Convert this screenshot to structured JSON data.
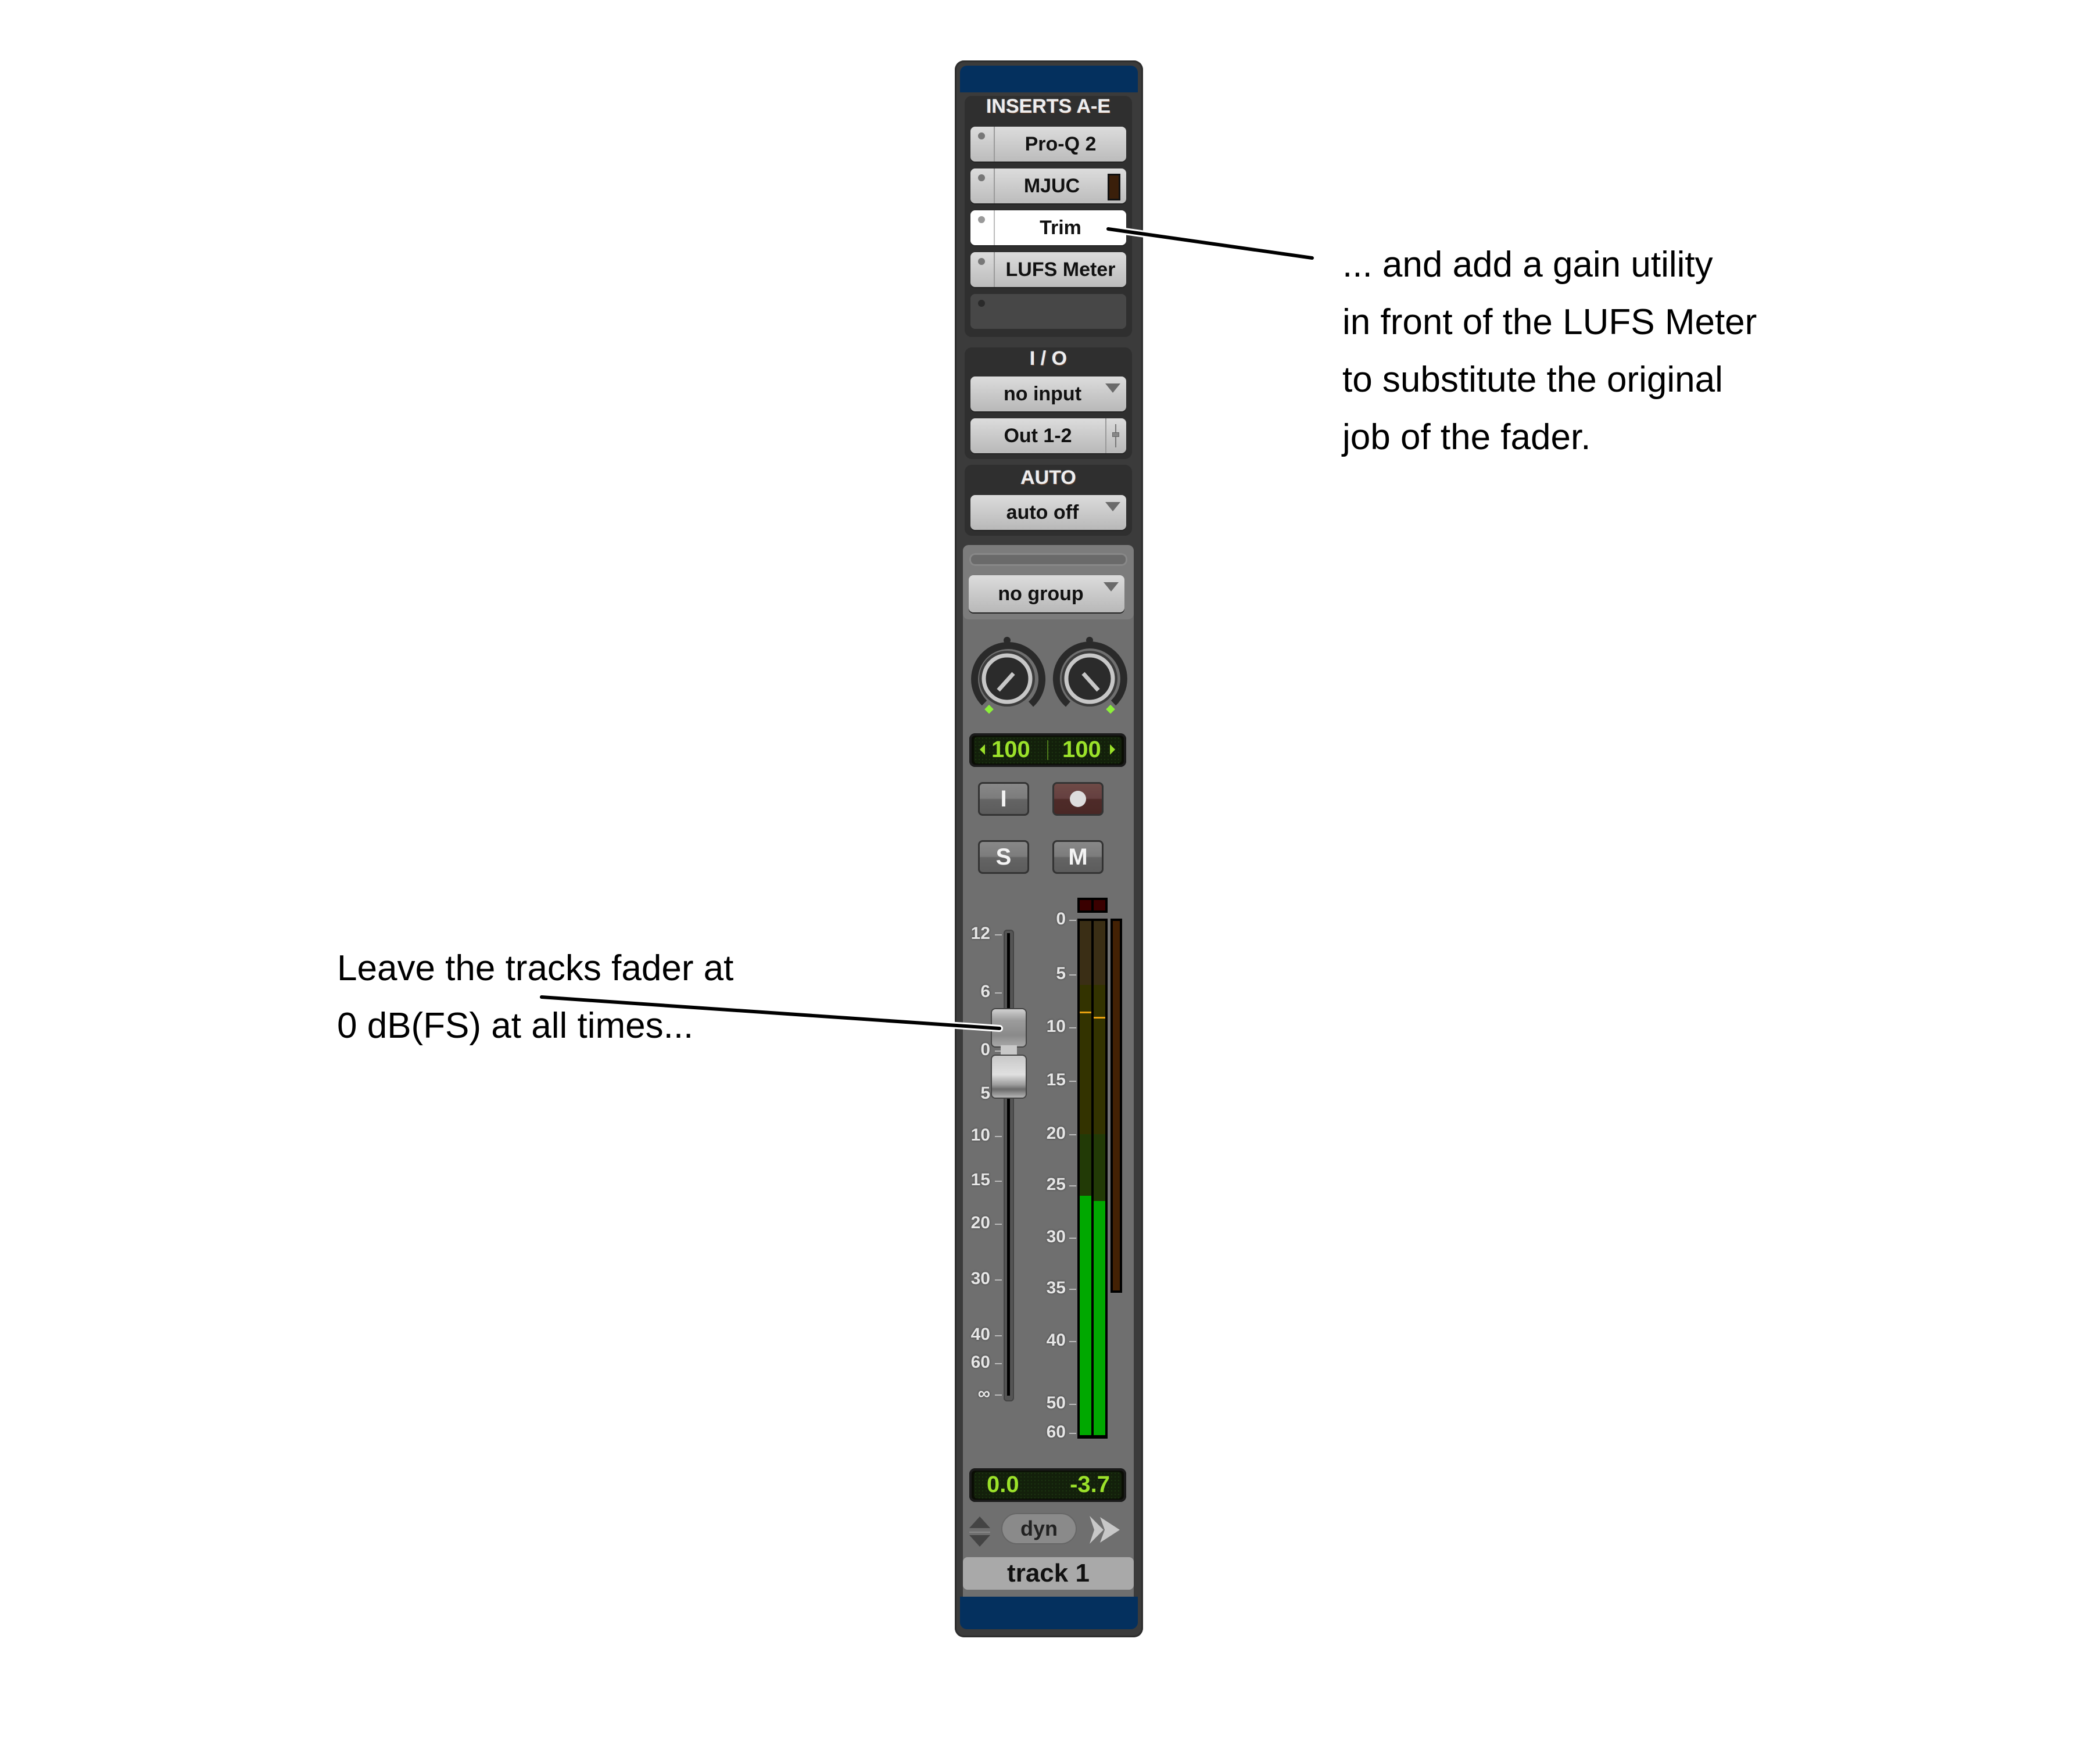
{
  "inserts": {
    "label": "INSERTS A-E",
    "slots": [
      {
        "name": "Pro-Q 2",
        "state": "normal"
      },
      {
        "name": "MJUC",
        "state": "normal"
      },
      {
        "name": "Trim",
        "state": "selected"
      },
      {
        "name": "LUFS Meter",
        "state": "normal"
      },
      {
        "name": "",
        "state": "empty"
      }
    ]
  },
  "io": {
    "label": "I / O",
    "input": "no input",
    "output": "Out 1-2"
  },
  "auto": {
    "label": "AUTO",
    "mode": "auto off"
  },
  "group": {
    "value": "no group"
  },
  "pan": {
    "left": "100",
    "right": "100",
    "left_knob_position": "full left",
    "right_knob_position": "full right"
  },
  "buttons": {
    "input_monitor": "I",
    "record": "●",
    "solo": "S",
    "mute": "M"
  },
  "fader": {
    "scale": [
      "12",
      "6",
      "0",
      "5",
      "10",
      "15",
      "20",
      "30",
      "40",
      "60",
      "∞"
    ],
    "value_db": 0.0
  },
  "meter": {
    "scale": [
      "0",
      "5",
      "10",
      "15",
      "20",
      "25",
      "30",
      "35",
      "40",
      "50",
      "60"
    ],
    "left_level_db": -26,
    "right_level_db": -26.5,
    "left_peak_db": -8.5,
    "right_peak_db": -9
  },
  "volume_display": {
    "volume": "0.0",
    "peak": "-3.7"
  },
  "footer": {
    "dyn_label": "dyn",
    "track_name": "track 1"
  },
  "colors": {
    "header_blue": "#04305e",
    "lcd_green": "#9be12a",
    "meter_green": "#00a800",
    "selected_insert": "#ffffff"
  },
  "annotations": {
    "right": [
      "... and add a gain utility",
      "in front of the LUFS Meter",
      "to substitute the original",
      "job of the fader."
    ],
    "left": [
      "Leave the tracks fader at",
      "0 dB(FS) at all times..."
    ]
  }
}
